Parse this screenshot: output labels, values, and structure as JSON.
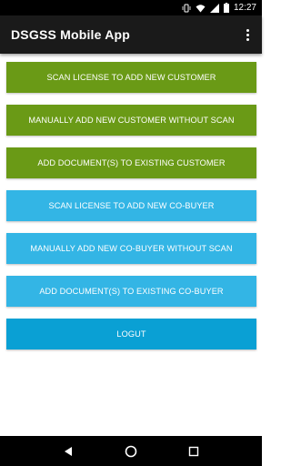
{
  "status_bar": {
    "time": "12:27",
    "icons": [
      "vibrate-icon",
      "wifi-icon",
      "signal-icon",
      "battery-icon"
    ]
  },
  "app_bar": {
    "title": "DSGSS Mobile App",
    "overflow_icon": "more-vert-icon"
  },
  "buttons": [
    {
      "label": "SCAN LICENSE TO ADD NEW CUSTOMER",
      "color": "#6a9a16"
    },
    {
      "label": "MANUALLY ADD NEW CUSTOMER WITHOUT SCAN",
      "color": "#6a9a16"
    },
    {
      "label": "ADD DOCUMENT(S) TO EXISTING CUSTOMER",
      "color": "#6a9a16"
    },
    {
      "label": "SCAN LICENSE TO ADD NEW CO-BUYER",
      "color": "#33b5e5"
    },
    {
      "label": "MANUALLY ADD NEW CO-BUYER WITHOUT SCAN",
      "color": "#33b5e5"
    },
    {
      "label": "ADD DOCUMENT(S) TO EXISTING CO-BUYER",
      "color": "#33b5e5"
    }
  ],
  "logout": {
    "label": "LOGUT",
    "color": "#0aa0d4"
  },
  "nav_bar": {
    "icons": [
      "back-icon",
      "home-icon",
      "recents-icon"
    ]
  }
}
